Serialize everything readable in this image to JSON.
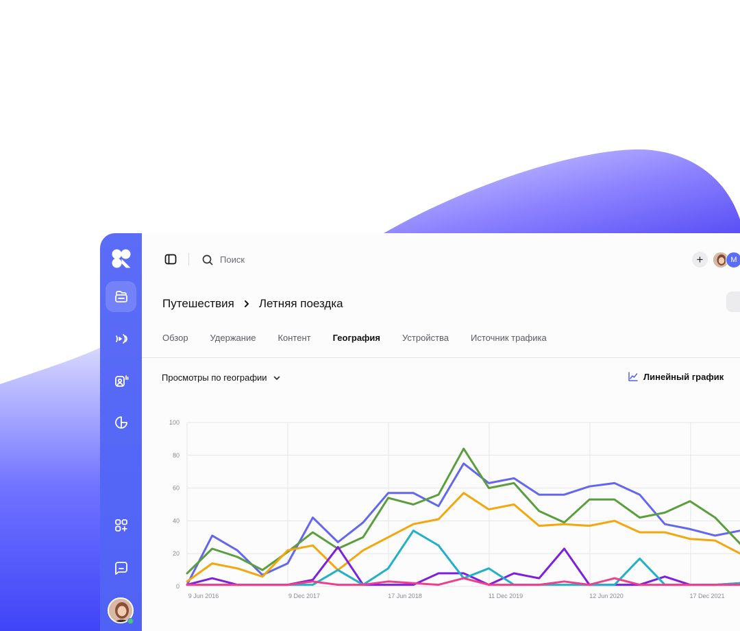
{
  "search": {
    "placeholder": "Поиск"
  },
  "header": {
    "plus_label": "+",
    "avatar_initial": "M"
  },
  "breadcrumb": {
    "parent": "Путешествия",
    "current": "Летняя поездка"
  },
  "tabs": [
    {
      "label": "Обзор",
      "active": false
    },
    {
      "label": "Удержание",
      "active": false
    },
    {
      "label": "Контент",
      "active": false
    },
    {
      "label": "География",
      "active": true
    },
    {
      "label": "Устройства",
      "active": false
    },
    {
      "label": "Источник трафика",
      "active": false
    }
  ],
  "subbar": {
    "metric": "Просмотры по географии",
    "chart_mode": "Линейный график"
  },
  "rail": {
    "items": [
      {
        "icon": "folder-icon",
        "active": true
      },
      {
        "icon": "broadcast-icon",
        "active": false
      },
      {
        "icon": "audience-icon",
        "active": false
      },
      {
        "icon": "pie-chart-icon",
        "active": false
      },
      {
        "icon": "add-apps-icon",
        "active": false
      },
      {
        "icon": "chat-icon",
        "active": false
      }
    ]
  },
  "chart_data": {
    "type": "line",
    "ylim": [
      0,
      100
    ],
    "yticks": [
      "0",
      "20",
      "40",
      "60",
      "80",
      "100"
    ],
    "xtick_labels": [
      "9 Jun 2016",
      "9 Dec 2017",
      "17 Jun 2018",
      "11 Dec 2019",
      "12 Jun 2020",
      "17 Dec 2021"
    ],
    "grid": true,
    "series": [
      {
        "color": "#6366f1",
        "values": [
          1,
          31,
          22,
          7,
          14,
          42,
          27,
          39,
          57,
          57,
          49,
          75,
          63,
          66,
          56,
          56,
          61,
          63,
          56,
          38,
          35,
          31,
          34
        ]
      },
      {
        "color": "#5a9e3d",
        "values": [
          8,
          23,
          18,
          10,
          21,
          33,
          23,
          30,
          54,
          50,
          56,
          84,
          60,
          63,
          46,
          39,
          53,
          53,
          42,
          45,
          52,
          42,
          26
        ]
      },
      {
        "color": "#f5a60b",
        "values": [
          3,
          14,
          11,
          6,
          22,
          25,
          10,
          22,
          30,
          38,
          41,
          57,
          47,
          50,
          37,
          38,
          37,
          40,
          33,
          33,
          29,
          28,
          20
        ]
      },
      {
        "color": "#7c1fe0",
        "values": [
          1,
          5,
          1,
          1,
          1,
          4,
          24,
          1,
          1,
          1,
          8,
          8,
          1,
          8,
          5,
          23,
          1,
          1,
          1,
          6,
          1,
          1,
          2
        ]
      },
      {
        "color": "#22b0c9",
        "values": [
          1,
          1,
          1,
          1,
          1,
          1,
          10,
          1,
          11,
          34,
          25,
          5,
          11,
          1,
          1,
          1,
          1,
          1,
          17,
          1,
          1,
          1,
          2
        ]
      },
      {
        "color": "#ef3f8a",
        "values": [
          1,
          1,
          1,
          1,
          1,
          3,
          1,
          1,
          3,
          2,
          1,
          5,
          1,
          1,
          1,
          3,
          1,
          5,
          1,
          1,
          1,
          1,
          1
        ]
      }
    ]
  }
}
